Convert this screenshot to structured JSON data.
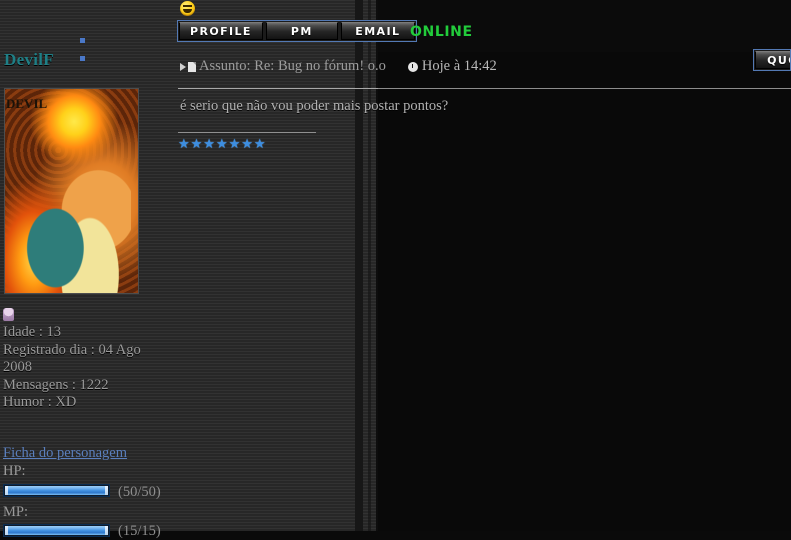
{
  "profile": {
    "username": "DevilF",
    "rank_dots_count": 2,
    "avatar_overlay_text": "DEVIL",
    "rank_icon_name": "rank-pixel-icon",
    "info_lines": [
      "Idade : 13",
      "Registrado dia : 04 Ago",
      "2008",
      "Mensagens : 1222",
      "Humor : XD"
    ],
    "ficha_link_label": "Ficha do personagem",
    "stats": [
      {
        "label": "HP:",
        "value_text": "(50/50)",
        "percent": 100
      },
      {
        "label": "MP:",
        "value_text": "(15/15)",
        "percent": 100
      }
    ]
  },
  "post": {
    "emoticon_name": "grin-smiley-icon",
    "buttons": [
      {
        "label": "PROFILE",
        "name": "profile-button"
      },
      {
        "label": "PM",
        "name": "pm-button"
      },
      {
        "label": "EMAIL",
        "name": "email-button"
      }
    ],
    "online_status": "ONLINE",
    "subject_prefix": "Assunto:",
    "subject": "Re: Bug no fórum! o.o",
    "timestamp": "Hoje à 14:42",
    "message": "é serio que não vou poder mais postar pontos?",
    "signature_stars": "★★★★★★★",
    "quote_button_label": "QUOTE"
  },
  "colors": {
    "username": "#1f7f86",
    "online": "#22cc3b",
    "link": "#5a7fbd",
    "button_border": "#5379b4",
    "star": "#3d8ee0",
    "body_text": "#b1b1b1"
  }
}
